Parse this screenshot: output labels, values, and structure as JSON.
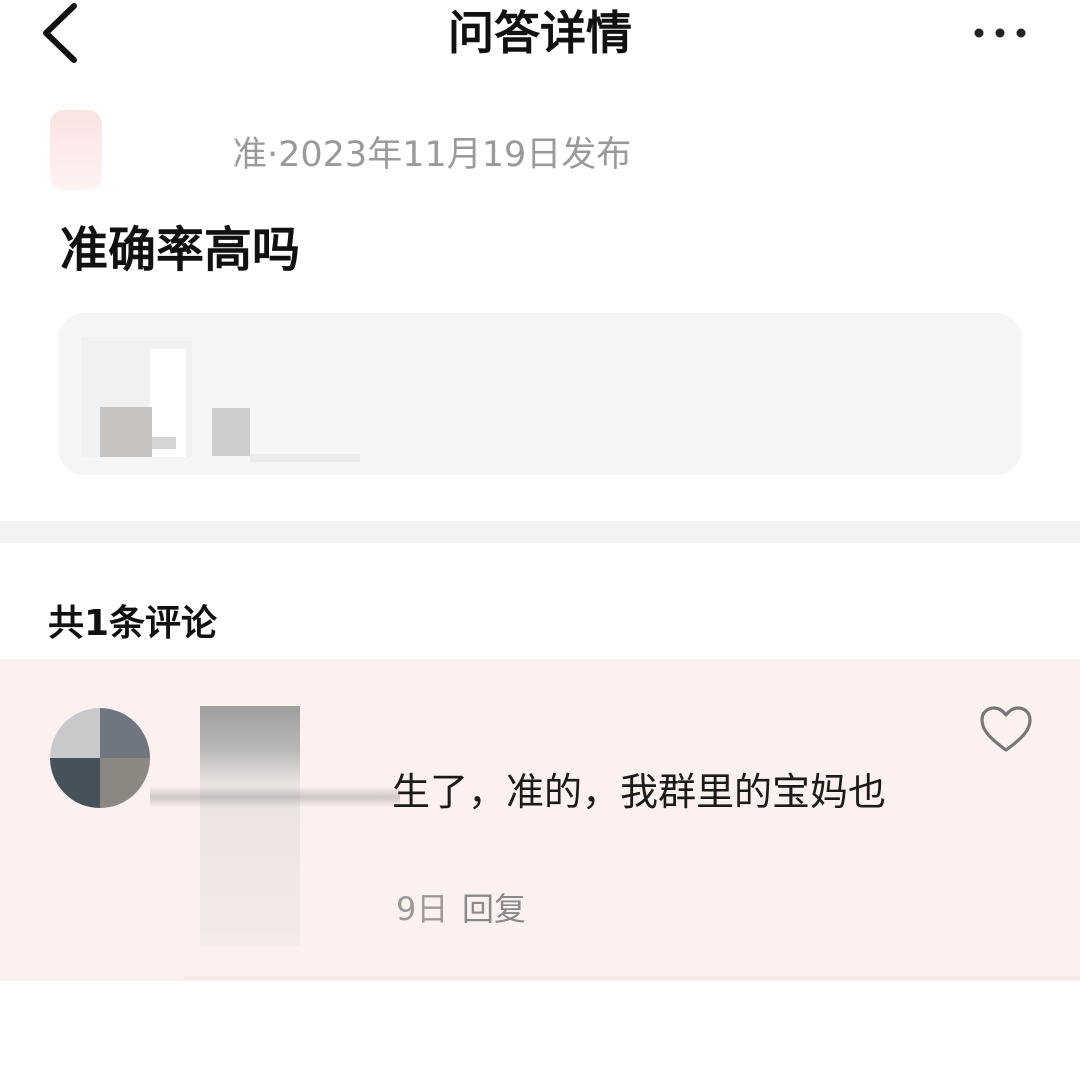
{
  "header": {
    "title": "问答详情",
    "back_icon": "chevron-left-icon",
    "more_icon": "more-horizontal-icon"
  },
  "post": {
    "meta": "准·2023年11月19日发布",
    "title": "准确率高吗"
  },
  "comments": {
    "count_label": "共1条评论",
    "items": [
      {
        "text": "生了，准的，我群里的宝妈也",
        "time": "9日",
        "reply_label": "回复",
        "like_icon": "heart-outline-icon"
      }
    ]
  },
  "colors": {
    "comment_highlight_bg": "#fdf1ef",
    "meta_text": "#9a9a9a",
    "card_bg": "#f6f6f6"
  }
}
